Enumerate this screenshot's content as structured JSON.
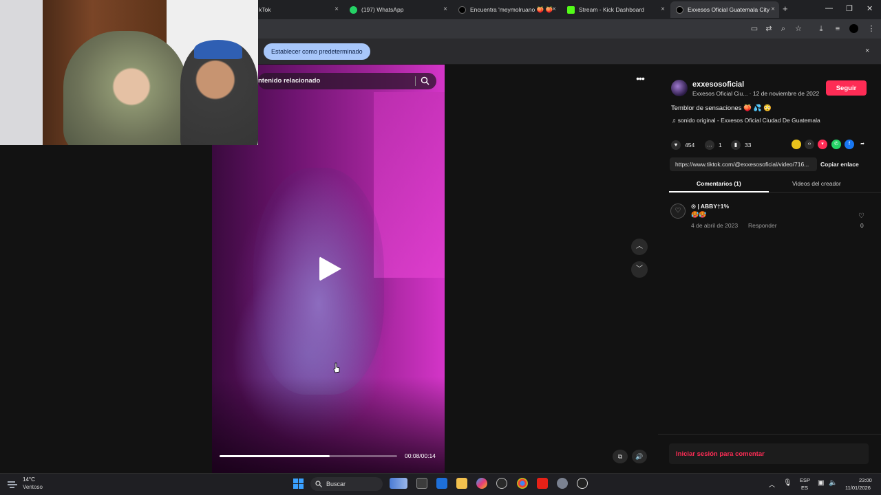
{
  "browser": {
    "tabs": [
      {
        "title": "kTok",
        "favicon_color": "#000000"
      },
      {
        "title": "(197) WhatsApp",
        "favicon_color": "#25d366"
      },
      {
        "title": "Encuentra 'meymolruano 🍑 🍑",
        "favicon_color": "#000000"
      },
      {
        "title": "Stream - Kick Dashboard",
        "favicon_color": "#53fc18"
      },
      {
        "title": "Exxesos Oficial Guatemala City",
        "favicon_color": "#000000"
      }
    ],
    "close_glyph": "×",
    "new_tab_glyph": "+",
    "infobar_button": "Establecer como predeterminado",
    "infobar_close": "×"
  },
  "video": {
    "search_placeholder": "ntenido relacionado",
    "time": "00:08/00:14",
    "progress": 0.62
  },
  "post": {
    "username": "exxesosoficial",
    "meta": "Exxesos Oficial Ciu... · 12 de noviembre de 2022",
    "follow_label": "Seguir",
    "description": "Temblor de sensaciones 🍑 💦 😳",
    "sound": "sonido original - Exxesos Oficial Ciudad De Guatemala",
    "likes": "454",
    "comments": "1",
    "saves": "33",
    "link": "https://www.tiktok.com/@exxesosoficial/video/716...",
    "copy_label": "Copiar enlace",
    "tabs": [
      "Comentarios (1)",
      "Videos del creador"
    ],
    "login_label": "Iniciar sesión para comentar"
  },
  "comment": {
    "author": "⊙ | ABBY†1%",
    "text": "🥵🥵",
    "date": "4 de abril de 2023",
    "reply_label": "Responder",
    "likes": "0"
  },
  "taskbar": {
    "temperature": "14°C",
    "condition": "Ventoso",
    "search_label": "Buscar",
    "lang_top": "ESP",
    "lang_bottom": "ES",
    "time": "23:00",
    "date": "11/01/2026"
  },
  "colors": {
    "accent": "#fe2c55",
    "default_btn": "#a8c7fa"
  }
}
